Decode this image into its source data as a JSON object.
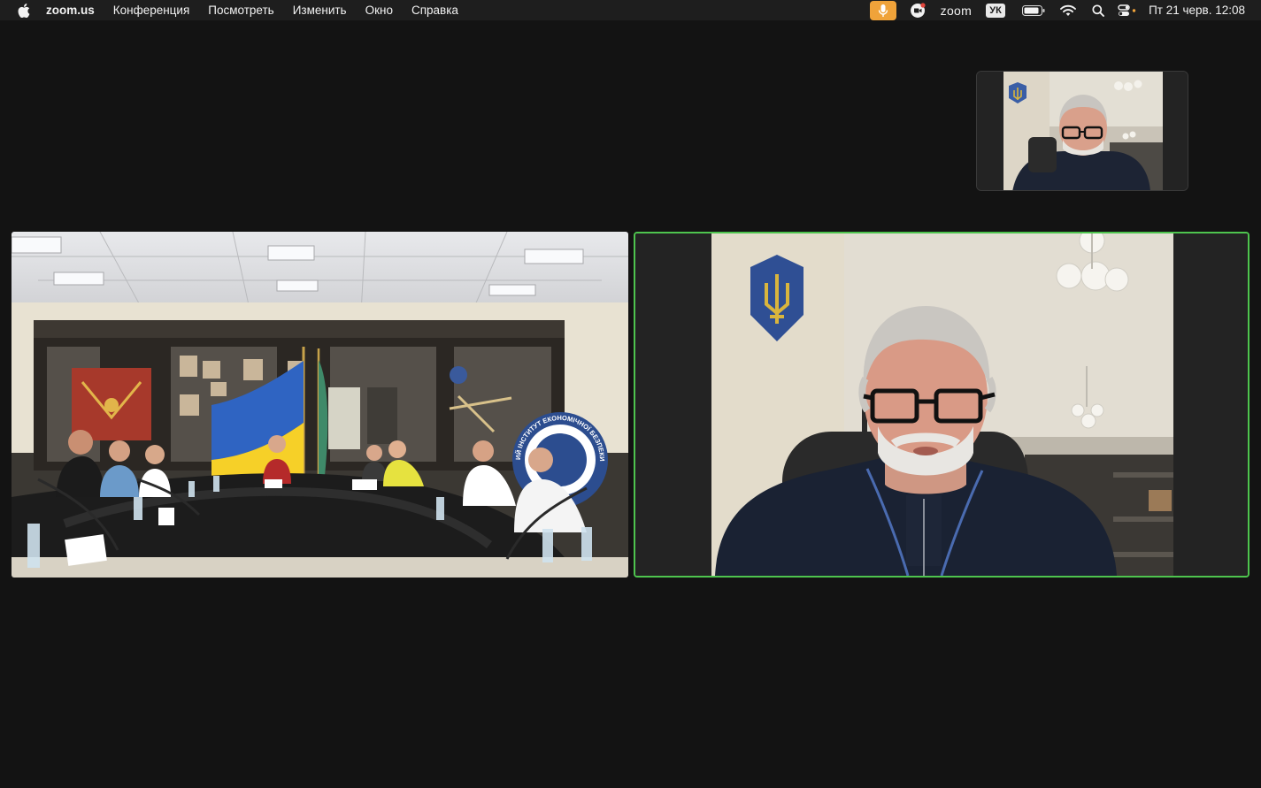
{
  "menubar": {
    "app_name": "zoom.us",
    "menus": [
      "Конференция",
      "Посмотреть",
      "Изменить",
      "Окно",
      "Справка"
    ],
    "tray": {
      "zoom_label": "zoom",
      "input_language": "УК",
      "datetime": "Пт 21 черв.  12:08"
    },
    "icons": [
      "apple-icon",
      "microphone-icon",
      "zoom-status-icon",
      "battery-icon",
      "wifi-icon",
      "search-icon",
      "control-center-icon"
    ],
    "colors": {
      "bar": "#1e1e1e",
      "mic_indicator": "#f0a33a"
    }
  },
  "meeting": {
    "participants": [
      {
        "role": "self-view-thumbnail"
      },
      {
        "role": "conference-room"
      },
      {
        "role": "active-speaker",
        "highlighted": true
      }
    ],
    "colors": {
      "background": "#131313",
      "active_speaker_border": "#4ec44e"
    },
    "room_banner_text": "ИЙ ІНСТИТУТ ЕКОНОМІЧНОЇ БЕЗПЕКИ ТА М"
  }
}
